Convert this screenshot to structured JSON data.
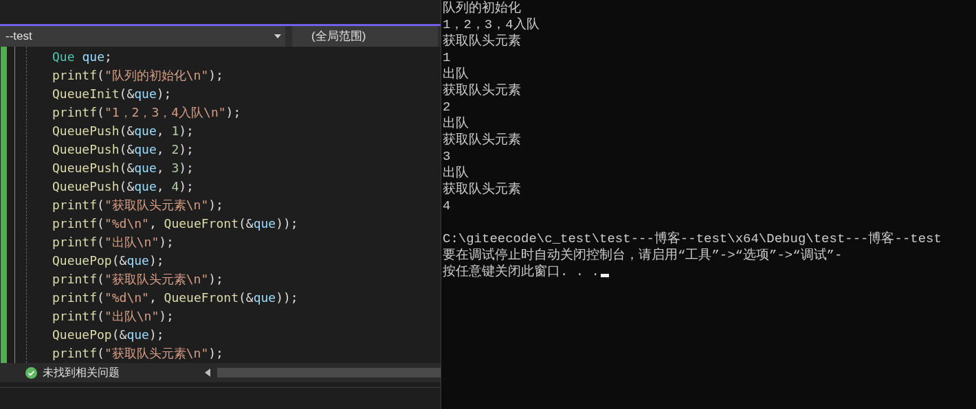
{
  "editor": {
    "project_dropdown": "--test",
    "scope_dropdown": "(全局范围)",
    "code_lines": [
      [
        {
          "kind": "type",
          "text": "Que"
        },
        {
          "kind": "var",
          "text": "que"
        },
        {
          "kind": "punct",
          "text": ";"
        }
      ],
      [
        {
          "kind": "func",
          "text": "printf"
        },
        {
          "kind": "punct",
          "text": "("
        },
        {
          "kind": "str",
          "text": "\"队列的初始化\\n\""
        },
        {
          "kind": "punct",
          "text": ");"
        }
      ],
      [
        {
          "kind": "func",
          "text": "QueueInit"
        },
        {
          "kind": "punct",
          "text": "(&"
        },
        {
          "kind": "var",
          "text": "que"
        },
        {
          "kind": "punct",
          "text": ");"
        }
      ],
      [
        {
          "kind": "func",
          "text": "printf"
        },
        {
          "kind": "punct",
          "text": "("
        },
        {
          "kind": "str",
          "text": "\"1，2，3，4入队\\n\""
        },
        {
          "kind": "punct",
          "text": ");"
        }
      ],
      [
        {
          "kind": "func",
          "text": "QueuePush"
        },
        {
          "kind": "punct",
          "text": "(&"
        },
        {
          "kind": "var",
          "text": "que"
        },
        {
          "kind": "punct",
          "text": ", "
        },
        {
          "kind": "num",
          "text": "1"
        },
        {
          "kind": "punct",
          "text": ");"
        }
      ],
      [
        {
          "kind": "func",
          "text": "QueuePush"
        },
        {
          "kind": "punct",
          "text": "(&"
        },
        {
          "kind": "var",
          "text": "que"
        },
        {
          "kind": "punct",
          "text": ", "
        },
        {
          "kind": "num",
          "text": "2"
        },
        {
          "kind": "punct",
          "text": ");"
        }
      ],
      [
        {
          "kind": "func",
          "text": "QueuePush"
        },
        {
          "kind": "punct",
          "text": "(&"
        },
        {
          "kind": "var",
          "text": "que"
        },
        {
          "kind": "punct",
          "text": ", "
        },
        {
          "kind": "num",
          "text": "3"
        },
        {
          "kind": "punct",
          "text": ");"
        }
      ],
      [
        {
          "kind": "func",
          "text": "QueuePush"
        },
        {
          "kind": "punct",
          "text": "(&"
        },
        {
          "kind": "var",
          "text": "que"
        },
        {
          "kind": "punct",
          "text": ", "
        },
        {
          "kind": "num",
          "text": "4"
        },
        {
          "kind": "punct",
          "text": ");"
        }
      ],
      [
        {
          "kind": "func",
          "text": "printf"
        },
        {
          "kind": "punct",
          "text": "("
        },
        {
          "kind": "str",
          "text": "\"获取队头元素\\n\""
        },
        {
          "kind": "punct",
          "text": ");"
        }
      ],
      [
        {
          "kind": "func",
          "text": "printf"
        },
        {
          "kind": "punct",
          "text": "("
        },
        {
          "kind": "str",
          "text": "\"%d\\n\""
        },
        {
          "kind": "punct",
          "text": ", "
        },
        {
          "kind": "func",
          "text": "QueueFront"
        },
        {
          "kind": "punct",
          "text": "(&"
        },
        {
          "kind": "var",
          "text": "que"
        },
        {
          "kind": "punct",
          "text": "));"
        }
      ],
      [
        {
          "kind": "func",
          "text": "printf"
        },
        {
          "kind": "punct",
          "text": "("
        },
        {
          "kind": "str",
          "text": "\"出队\\n\""
        },
        {
          "kind": "punct",
          "text": ");"
        }
      ],
      [
        {
          "kind": "func",
          "text": "QueuePop"
        },
        {
          "kind": "punct",
          "text": "(&"
        },
        {
          "kind": "var",
          "text": "que"
        },
        {
          "kind": "punct",
          "text": ");"
        }
      ],
      [
        {
          "kind": "func",
          "text": "printf"
        },
        {
          "kind": "punct",
          "text": "("
        },
        {
          "kind": "str",
          "text": "\"获取队头元素\\n\""
        },
        {
          "kind": "punct",
          "text": ");"
        }
      ],
      [
        {
          "kind": "func",
          "text": "printf"
        },
        {
          "kind": "punct",
          "text": "("
        },
        {
          "kind": "str",
          "text": "\"%d\\n\""
        },
        {
          "kind": "punct",
          "text": ", "
        },
        {
          "kind": "func",
          "text": "QueueFront"
        },
        {
          "kind": "punct",
          "text": "(&"
        },
        {
          "kind": "var",
          "text": "que"
        },
        {
          "kind": "punct",
          "text": "));"
        }
      ],
      [
        {
          "kind": "func",
          "text": "printf"
        },
        {
          "kind": "punct",
          "text": "("
        },
        {
          "kind": "str",
          "text": "\"出队\\n\""
        },
        {
          "kind": "punct",
          "text": ");"
        }
      ],
      [
        {
          "kind": "func",
          "text": "QueuePop"
        },
        {
          "kind": "punct",
          "text": "(&"
        },
        {
          "kind": "var",
          "text": "que"
        },
        {
          "kind": "punct",
          "text": ");"
        }
      ],
      [
        {
          "kind": "func",
          "text": "printf"
        },
        {
          "kind": "punct",
          "text": "("
        },
        {
          "kind": "str",
          "text": "\"获取队头元素\\n\""
        },
        {
          "kind": "punct",
          "text": ");"
        }
      ]
    ],
    "status": "未找到相关问题"
  },
  "console": {
    "lines": [
      "队列的初始化",
      "1，2，3，4入队",
      "获取队头元素",
      "1",
      "出队",
      "获取队头元素",
      "2",
      "出队",
      "获取队头元素",
      "3",
      "出队",
      "获取队头元素",
      "4",
      "C:\\giteecode\\c_test\\test---博客--test\\x64\\Debug\\test---博客--test",
      "要在调试停止时自动关闭控制台，请启用“工具”->“选项”->“调试”-",
      "按任意键关闭此窗口. . ."
    ]
  }
}
